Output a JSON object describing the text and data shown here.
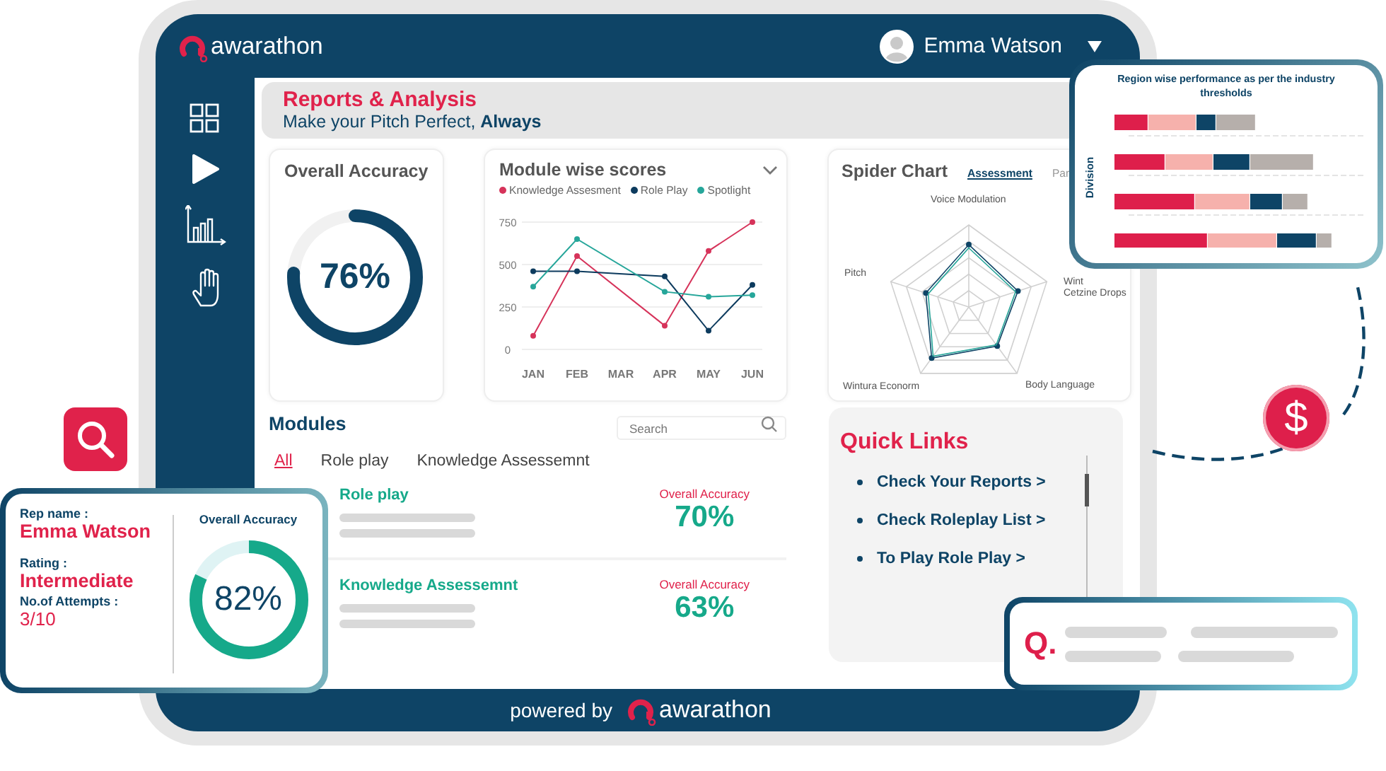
{
  "header": {
    "logo": "awarathon",
    "user": "Emma Watson"
  },
  "sidebar": {
    "items": [
      {
        "kind": "grid"
      },
      {
        "kind": "play"
      },
      {
        "kind": "chart"
      },
      {
        "kind": "hand"
      }
    ]
  },
  "page_title": "Reports & Analysis",
  "page_subtitle": "Make your Pitch Perfect, **Always**",
  "overall_accuracy": {
    "title": "Overall Accuracy",
    "value": "76%"
  },
  "module_scores": {
    "title": "Module wise scores",
    "chart_data": {
      "type": "line",
      "categories": [
        "JAN",
        "FEB",
        "MAR",
        "APR",
        "MAY",
        "JUN"
      ],
      "ylim": [
        0,
        750
      ],
      "yticks": [
        0,
        250,
        500,
        750
      ],
      "series": [
        {
          "name": "Knowledge Assesment",
          "color": "#d6335a",
          "marker": "circle",
          "values": [
            80,
            550,
            null,
            140,
            580,
            750
          ]
        },
        {
          "name": "Role Play",
          "color": "#0d3b5e",
          "marker": "circle",
          "values": [
            460,
            460,
            null,
            430,
            110,
            380
          ]
        },
        {
          "name": "Spotlight",
          "color": "#26a69a",
          "marker": "circle",
          "values": [
            370,
            650,
            null,
            340,
            310,
            320
          ]
        }
      ]
    }
  },
  "spider_chart": {
    "title": "Spider Chart",
    "tabs": [
      {
        "label": "Assessment",
        "selected": true
      },
      {
        "label": "Par",
        "selected": false
      }
    ],
    "axes": [
      "Voice Modulation",
      "Pitch",
      "Wint\nCetzine Drops",
      "Wintura Econorm",
      "Body Language"
    ]
  },
  "modules": {
    "title": "Modules",
    "search": {
      "placeholder": "Search"
    },
    "tabs": [
      {
        "label": "All",
        "selected": true
      },
      {
        "label": "Role play",
        "selected": false
      },
      {
        "label": "Knowledge Assessemnt",
        "selected": false
      }
    ],
    "rows": [
      {
        "title": "Role play",
        "metric_label": "Overall Accuracy",
        "metric": "70%"
      },
      {
        "title": "Knowledge Assessemnt",
        "metric_label": "Overall Accuracy",
        "metric": "63%"
      }
    ]
  },
  "quick_links": {
    "title": "Quick Links",
    "items": [
      "Check Your Reports >",
      "Check Roleplay List >",
      "To Play Role Play >"
    ]
  },
  "footer": {
    "text": "powered by",
    "logo": "awarathon"
  },
  "rep_card": {
    "name_label": "Rep name :",
    "name": "Emma Watson",
    "rating_label": "Rating :",
    "rating": "Intermediate",
    "attempts_label": "No.of Attempts :",
    "attempts": "3/10",
    "accuracy_label": "Overall Accuracy",
    "accuracy": "82%"
  },
  "region_card": {
    "title": "Region wise performance as per the industry thresholds",
    "ylabel": "Division"
  },
  "dollar_badge": "$",
  "question_card": {
    "mark": "Q."
  }
}
